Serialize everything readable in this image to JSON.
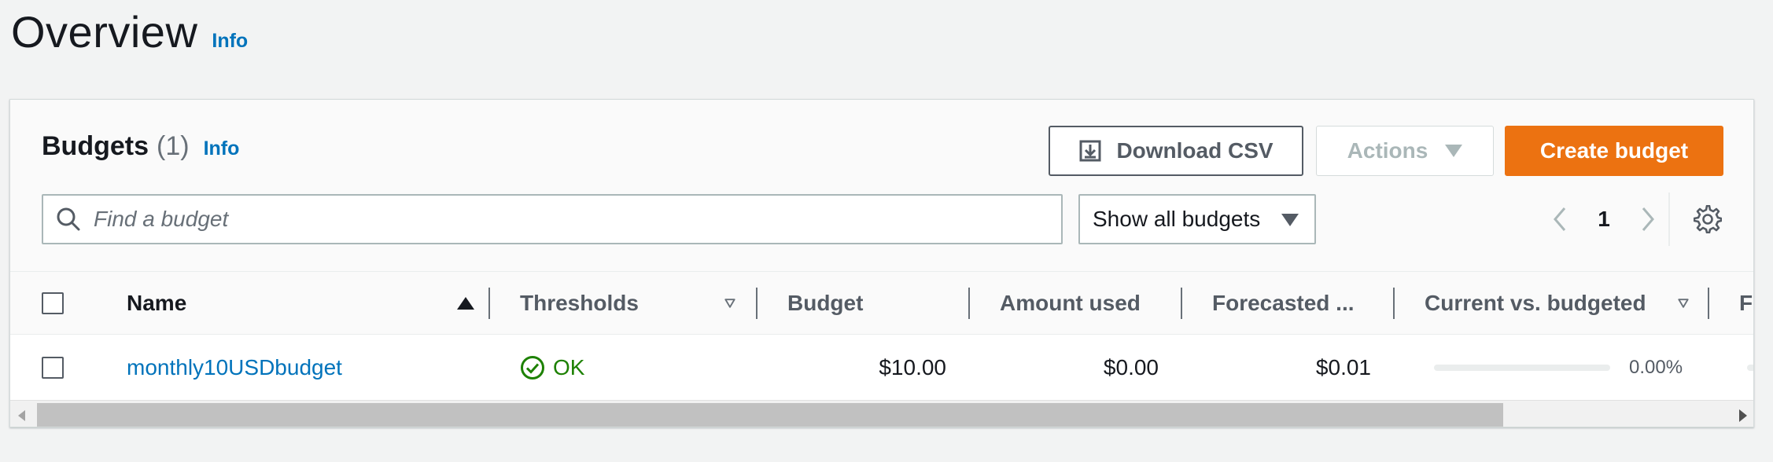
{
  "page": {
    "title": "Overview",
    "info": "Info"
  },
  "panel": {
    "title": "Budgets",
    "count": "(1)",
    "info": "Info",
    "buttons": {
      "download": "Download CSV",
      "actions": "Actions",
      "create": "Create budget"
    },
    "search": {
      "placeholder": "Find a budget",
      "value": ""
    },
    "filter": {
      "selected": "Show all budgets"
    },
    "pagination": {
      "current_page": "1"
    }
  },
  "table": {
    "columns": [
      "Name",
      "Thresholds",
      "Budget",
      "Amount used",
      "Forecasted ...",
      "Current vs. budgeted",
      "Fo"
    ],
    "sort": {
      "column": "Name",
      "direction": "ascending"
    },
    "rows": [
      {
        "name": "monthly10USDbudget",
        "thresholds": "OK",
        "budget": "$10.00",
        "amount_used": "$0.00",
        "forecasted": "$0.01",
        "current_vs_budgeted": "0.00%",
        "current_vs_budgeted_fraction": 0.0
      }
    ]
  },
  "colors": {
    "primary_button": "#ec7211",
    "link": "#0073bb",
    "ok_status": "#1d8102",
    "page_background": "#f2f3f3"
  },
  "icons": {
    "download": "download-icon",
    "search": "search-icon",
    "caret": "caret-down-icon",
    "prev": "chevron-left-icon",
    "next": "chevron-right-icon",
    "settings": "gear-icon",
    "status_ok": "check-circle-icon",
    "sort_asc": "sort-ascending-icon",
    "sort_neutral": "sort-descending-outline-icon"
  }
}
